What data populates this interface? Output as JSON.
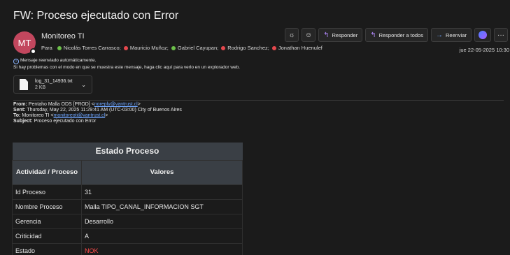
{
  "email": {
    "subject": "FW: Proceso ejecutado con Error",
    "avatar_initials": "MT",
    "sender": "Monitoreo TI",
    "to_label": "Para",
    "recipients": [
      {
        "name": "Nicolás Torres Carrasco;",
        "status": "#6cc04a"
      },
      {
        "name": "Mauricio Muñoz;",
        "status": "#e5484d"
      },
      {
        "name": "Gabriel Cayupan;",
        "status": "#6cc04a"
      },
      {
        "name": "Rodrigo Sanchez;",
        "status": "#e5484d"
      },
      {
        "name": "Jonathan Huenulef",
        "status": "#e5484d"
      }
    ],
    "date": "jue 22-05-2025 10:30",
    "notice_line1": "Mensaje reenviado automáticamente.",
    "notice_line2": "Si hay problemas con el modo en que se muestra este mensaje, haga clic aquí para verlo en un explorador web.",
    "attachment": {
      "name": "log_31_14936.txt",
      "size": "2 KB"
    }
  },
  "toolbar": {
    "reply": "Responder",
    "reply_all": "Responder a todos",
    "forward": "Reenviar",
    "more": "···"
  },
  "forwarded": {
    "from_label": "From:",
    "from_text": "Pentaho Malla ODS [PROD] <",
    "from_email": "noreply@vantrust.cl",
    "from_end": ">",
    "sent_label": "Sent:",
    "sent_text": "Thursday, May 22, 2025 11:29:41 AM (UTC-03:00) City of Buenos Aires",
    "to_label": "To:",
    "to_text": "Monitoreo TI <",
    "to_email": "monitoreoti@vantrust.cl",
    "to_end": ">",
    "subject_label": "Subject:",
    "subject_text": "Proceso ejecutado con Error"
  },
  "table": {
    "title": "Estado Proceso",
    "col1_header": "Actividad / Proceso",
    "col2_header": "Valores",
    "rows": [
      {
        "label": "Id Proceso",
        "value": "31"
      },
      {
        "label": "Nombre Proceso",
        "value": "Malla TIPO_CANAL_INFORMACION SGT"
      },
      {
        "label": "Gerencia",
        "value": "Desarrollo"
      },
      {
        "label": "Criticidad",
        "value": "A"
      },
      {
        "label": "Estado",
        "value": "NOK"
      }
    ]
  },
  "colors": {
    "avatar": "#c2475e",
    "status_error": "#ff4b4b",
    "link": "#6fa6ff",
    "table_header": "#3a3f45"
  }
}
